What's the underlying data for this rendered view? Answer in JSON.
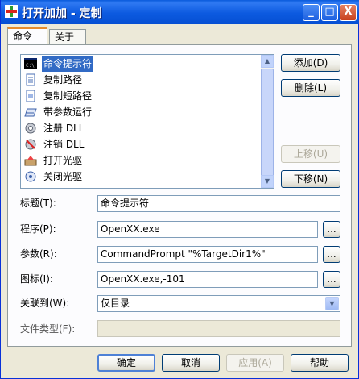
{
  "window": {
    "title": "打开加加 - 定制",
    "minimize": "_",
    "maximize": "□",
    "close": "X"
  },
  "tabs": [
    {
      "label": "命令"
    },
    {
      "label": "关于"
    }
  ],
  "command_list": {
    "items": [
      {
        "label": "命令提示符",
        "icon": "command-prompt-icon",
        "selected": true
      },
      {
        "label": "复制路径",
        "icon": "copy-path-icon"
      },
      {
        "label": "复制短路径",
        "icon": "copy-short-path-icon"
      },
      {
        "label": "带参数运行",
        "icon": "run-with-args-icon"
      },
      {
        "label": "注册 DLL",
        "icon": "register-dll-icon"
      },
      {
        "label": "注销 DLL",
        "icon": "unregister-dll-icon"
      },
      {
        "label": "打开光驱",
        "icon": "open-cdrom-icon"
      },
      {
        "label": "关闭光驱",
        "icon": "close-cdrom-icon"
      }
    ]
  },
  "side_buttons": {
    "add": "添加(D)",
    "delete": "删除(L)",
    "move_up": "上移(U)",
    "move_down": "下移(N)"
  },
  "form": {
    "title_label": "标题(T):",
    "title_value": "命令提示符",
    "program_label": "程序(P):",
    "program_value": "OpenXX.exe",
    "params_label": "参数(R):",
    "params_value": "CommandPrompt \"%TargetDir1%\"",
    "icon_label": "图标(I):",
    "icon_value": "OpenXX.exe,-101",
    "associate_label": "关联到(W):",
    "associate_value": "仅目录",
    "filetype_label": "文件类型(F):",
    "filetype_value": "",
    "browse": "..."
  },
  "bottom_buttons": {
    "ok": "确定",
    "cancel": "取消",
    "apply": "应用(A)",
    "help": "帮助"
  },
  "colors": {
    "titlebar": "#0c5ae0",
    "selection": "#316ac5",
    "window_bg": "#ece9d8"
  }
}
